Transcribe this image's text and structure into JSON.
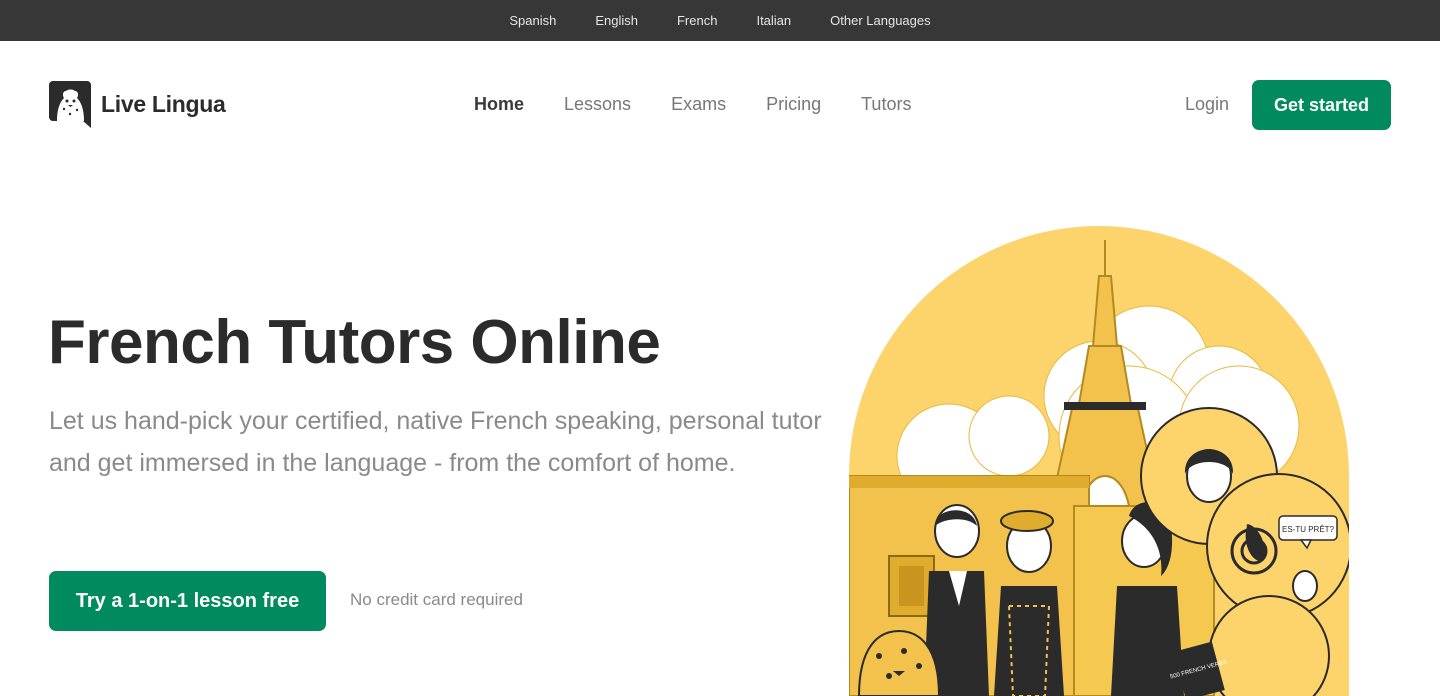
{
  "lang_bar": {
    "items": [
      "Spanish",
      "English",
      "French",
      "Italian",
      "Other Languages"
    ]
  },
  "header": {
    "logo_text": "Live Lingua",
    "nav": [
      "Home",
      "Lessons",
      "Exams",
      "Pricing",
      "Tutors"
    ],
    "active_nav": "Home",
    "login": "Login",
    "get_started": "Get started"
  },
  "hero": {
    "title": "French Tutors Online",
    "subtitle": "Let us hand-pick your certified, native French speaking, personal tutor and get immersed in the language - from the comfort of home.",
    "cta": "Try a 1-on-1 lesson free",
    "note": "No credit card required"
  },
  "illustration": {
    "speech_bubble": "ES-TU PRÊT?",
    "book_text": "500 FRENCH VERBS"
  },
  "colors": {
    "accent": "#008a5d",
    "top_bar": "#373737",
    "illustration_yellow": "#fdd36b"
  }
}
